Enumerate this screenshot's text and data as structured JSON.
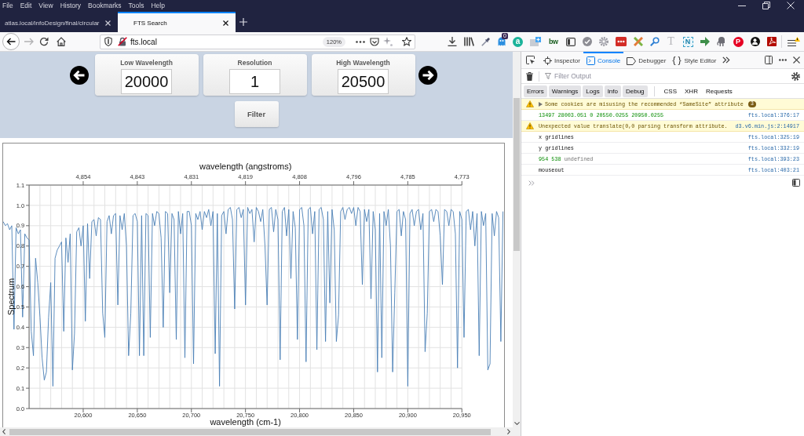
{
  "menu": [
    "File",
    "Edit",
    "View",
    "History",
    "Bookmarks",
    "Tools",
    "Help"
  ],
  "tabs": [
    {
      "label": "atlas.local/infoDesign/final/circular",
      "selected": false
    },
    {
      "label": "FTS Search",
      "selected": true
    }
  ],
  "toolbar": {
    "url": "fts.local",
    "zoom": "120%",
    "badge": "0",
    "extension_labels": [
      "a",
      "bw",
      "T",
      "N",
      "P"
    ]
  },
  "page": {
    "range_controls": [
      {
        "label": "Low Wavelength",
        "value": "20000"
      },
      {
        "label": "Resolution",
        "value": "1"
      },
      {
        "label": "High Wavelength",
        "value": "20500"
      }
    ],
    "filter_button": {
      "label": "Filter"
    },
    "chart_data": {
      "type": "line",
      "title": "wavelength (angstroms)",
      "xlabel": "wavelength (cm-1)",
      "ylabel": "Spectrum",
      "grid": true,
      "x": [
        20526,
        20528,
        20530,
        20532,
        20534,
        20536,
        20538,
        20540,
        20542,
        20544,
        20546,
        20548,
        20550,
        20552,
        20554,
        20556,
        20558,
        20560,
        20562,
        20564,
        20566,
        20568,
        20570,
        20572,
        20574,
        20576,
        20578,
        20580,
        20582,
        20584,
        20586,
        20588,
        20590,
        20592,
        20594,
        20596,
        20598,
        20600,
        20602,
        20604,
        20606,
        20608,
        20610,
        20612,
        20614,
        20616,
        20618,
        20620,
        20622,
        20624,
        20626,
        20628,
        20630,
        20632,
        20634,
        20636,
        20638,
        20640,
        20642,
        20644,
        20646,
        20648,
        20650,
        20652,
        20654,
        20656,
        20658,
        20660,
        20662,
        20664,
        20666,
        20668,
        20670,
        20672,
        20674,
        20676,
        20678,
        20680,
        20682,
        20684,
        20686,
        20688,
        20690,
        20692,
        20694,
        20696,
        20698,
        20700,
        20702,
        20704,
        20706,
        20708,
        20710,
        20712,
        20714,
        20716,
        20718,
        20720,
        20722,
        20724,
        20726,
        20728,
        20730,
        20732,
        20734,
        20736,
        20738,
        20740,
        20742,
        20744,
        20746,
        20748,
        20750,
        20752,
        20754,
        20756,
        20758,
        20760,
        20762,
        20764,
        20766,
        20768,
        20770,
        20772,
        20774,
        20776,
        20778,
        20780,
        20782,
        20784,
        20786,
        20788,
        20790,
        20792,
        20794,
        20796,
        20798,
        20800,
        20802,
        20804,
        20806,
        20808,
        20810,
        20812,
        20814,
        20816,
        20818,
        20820,
        20822,
        20824,
        20826,
        20828,
        20830,
        20832,
        20834,
        20836,
        20838,
        20840,
        20842,
        20844,
        20846,
        20848,
        20850,
        20852,
        20854,
        20856,
        20858,
        20860,
        20862,
        20864,
        20866,
        20868,
        20870,
        20872,
        20874,
        20876,
        20878,
        20880,
        20882,
        20884,
        20886,
        20888,
        20890,
        20892,
        20894,
        20896,
        20898,
        20900,
        20902,
        20904,
        20906,
        20908,
        20910,
        20912,
        20914,
        20916,
        20918,
        20920,
        20922,
        20924,
        20926,
        20928,
        20930,
        20932,
        20934,
        20936,
        20938,
        20940,
        20942,
        20944,
        20946,
        20948,
        20950,
        20952,
        20954,
        20956,
        20958,
        20960,
        20962,
        20964,
        20966,
        20968,
        20970,
        20972,
        20974,
        20976,
        20978,
        20980,
        20982,
        20984,
        20986,
        20988
      ],
      "series": [
        {
          "color": "#4a7fb5",
          "values": [
            0.92,
            0.9,
            0.91,
            0.88,
            0.9,
            0.39,
            0.89,
            0.86,
            0.88,
            0.45,
            0.86,
            0.84,
            0.83,
            0.38,
            0.26,
            0.74,
            0.62,
            0.45,
            0.25,
            0.14,
            0.18,
            0.45,
            0.62,
            0.11,
            0.74,
            0.78,
            0.8,
            0.82,
            0.38,
            0.84,
            0.72,
            0.86,
            0.19,
            0.37,
            0.87,
            0.89,
            0.8,
            0.9,
            0.43,
            0.91,
            0.64,
            0.92,
            0.93,
            0.85,
            0.94,
            0.93,
            0.47,
            0.35,
            0.92,
            0.95,
            0.86,
            0.95,
            0.96,
            0.51,
            0.95,
            0.88,
            0.96,
            0.8,
            0.26,
            0.47,
            0.95,
            0.96,
            0.92,
            0.26,
            0.95,
            0.26,
            0.96,
            0.95,
            0.35,
            0.96,
            0.9,
            0.97,
            0.96,
            0.84,
            0.4,
            0.97,
            0.96,
            0.57,
            0.96,
            0.93,
            0.34,
            0.97,
            0.86,
            0.96,
            0.25,
            0.97,
            0.97,
            0.9,
            0.22,
            0.96,
            0.93,
            0.97,
            0.88,
            0.97,
            0.94,
            0.98,
            0.9,
            0.97,
            0.27,
            0.96,
            0.11,
            0.95,
            0.97,
            0.86,
            0.98,
            0.99,
            0.93,
            0.49,
            0.98,
            0.99,
            0.94,
            0.98,
            0.51,
            0.99,
            0.96,
            0.98,
            0.82,
            0.99,
            0.97,
            0.92,
            0.98,
            0.8,
            0.51,
            0.98,
            0.99,
            0.87,
            0.98,
            0.93,
            0.24,
            0.97,
            0.99,
            0.85,
            0.98,
            0.64,
            0.97,
            0.89,
            0.34,
            0.98,
            0.99,
            0.9,
            0.23,
            0.98,
            0.99,
            0.86,
            0.97,
            0.29,
            0.98,
            0.99,
            0.93,
            0.33,
            0.97,
            0.52,
            0.98,
            0.88,
            0.33,
            0.46,
            0.97,
            0.99,
            0.93,
            0.98,
            0.99,
            0.96,
            0.99,
            0.9,
            0.99,
            0.97,
            0.61,
            0.98,
            0.92,
            0.98,
            0.54,
            0.97,
            0.88,
            0.18,
            0.96,
            0.25,
            0.97,
            0.9,
            0.98,
            0.8,
            0.18,
            0.57,
            0.97,
            0.98,
            0.85,
            0.97,
            0.93,
            0.11,
            0.96,
            0.98,
            0.9,
            0.97,
            0.98,
            0.88,
            0.96,
            0.28,
            0.47,
            0.97,
            0.98,
            0.92,
            0.98,
            0.97,
            0.85,
            0.61,
            0.98,
            0.97,
            0.9,
            0.98,
            0.97,
            0.86,
            0.2,
            0.97,
            0.93,
            0.35,
            0.97,
            0.98,
            0.88,
            0.97,
            0.8,
            0.96,
            0.26,
            0.97,
            0.9,
            0.96,
            0.19,
            0.22,
            0.96,
            0.85,
            0.97,
            0.94,
            0.33,
            0.97
          ]
        }
      ],
      "xlim": [
        20526,
        20989
      ],
      "ylim": [
        0,
        1.1
      ],
      "xticks": [
        {
          "value": 20600,
          "label": "20,600"
        },
        {
          "value": 20650,
          "label": "20,650"
        },
        {
          "value": 20700,
          "label": "20,700"
        },
        {
          "value": 20750,
          "label": "20,750"
        },
        {
          "value": 20800,
          "label": "20,800"
        },
        {
          "value": 20850,
          "label": "20,850"
        },
        {
          "value": 20900,
          "label": "20,900"
        },
        {
          "value": 20950,
          "label": "20,950"
        }
      ],
      "yticks": [
        {
          "value": 0,
          "label": "0.0"
        },
        {
          "value": 0.1,
          "label": "0.1"
        },
        {
          "value": 0.2,
          "label": "0.2"
        },
        {
          "value": 0.3,
          "label": "0.3"
        },
        {
          "value": 0.4,
          "label": "0.4"
        },
        {
          "value": 0.5,
          "label": "0.5"
        },
        {
          "value": 0.6,
          "label": "0.6"
        },
        {
          "value": 0.7,
          "label": "0.7"
        },
        {
          "value": 0.8,
          "label": "0.8"
        },
        {
          "value": 0.9,
          "label": "0.9"
        },
        {
          "value": 1.0,
          "label": "1.0"
        },
        {
          "value": 1.1,
          "label": "1.1"
        }
      ],
      "annotations": [
        "4,854",
        "4,843",
        "4,831",
        "4,819",
        "4,808",
        "4,796",
        "4,785",
        "4,773"
      ]
    }
  },
  "devtools": {
    "tabs": [
      {
        "label": "Inspector",
        "selected": false
      },
      {
        "label": "Console",
        "selected": true
      },
      {
        "label": "Debugger",
        "selected": false
      },
      {
        "label": "Style Editor",
        "selected": false
      }
    ],
    "filter": {
      "placeholder": "Filter Output"
    },
    "log_levels": [
      {
        "label": "Errors",
        "on": true
      },
      {
        "label": "Warnings",
        "on": true
      },
      {
        "label": "Logs",
        "on": true
      },
      {
        "label": "Info",
        "on": true
      },
      {
        "label": "Debug",
        "on": true
      }
    ],
    "request_types": [
      {
        "label": "CSS",
        "on": false
      },
      {
        "label": "XHR",
        "on": false
      },
      {
        "label": "Requests",
        "on": false
      }
    ],
    "messages": [
      {
        "kind": "warning",
        "expanded": false,
        "parts": [
          {
            "kind": "plain",
            "text": "Some cookies are misusing the recommended “SameSite” attribute"
          }
        ],
        "count": "3"
      },
      {
        "kind": "log",
        "parts": [
          {
            "kind": "number",
            "text": "13497 28003.051 0 20550.0255 20950.0255"
          }
        ],
        "source": "fts.local:376:17"
      },
      {
        "kind": "warning",
        "parts": [
          {
            "kind": "plain",
            "text": "Unexpected value translate(0,0 parsing transform attribute."
          }
        ],
        "source": "d3.v6.min.js:2:14917"
      },
      {
        "kind": "log",
        "parts": [
          {
            "kind": "plain",
            "text": "x gridlines"
          }
        ],
        "source": "fts.local:325:19"
      },
      {
        "kind": "log",
        "parts": [
          {
            "kind": "plain",
            "text": "y gridlines"
          }
        ],
        "source": "fts.local:332:19"
      },
      {
        "kind": "log",
        "parts": [
          {
            "kind": "number",
            "text": "954 538"
          },
          {
            "kind": "undefined",
            "text": "undefined"
          }
        ],
        "source": "fts.local:393:23"
      },
      {
        "kind": "log",
        "parts": [
          {
            "kind": "plain",
            "text": "mouseout"
          }
        ],
        "source": "fts.local:403:21"
      }
    ]
  }
}
